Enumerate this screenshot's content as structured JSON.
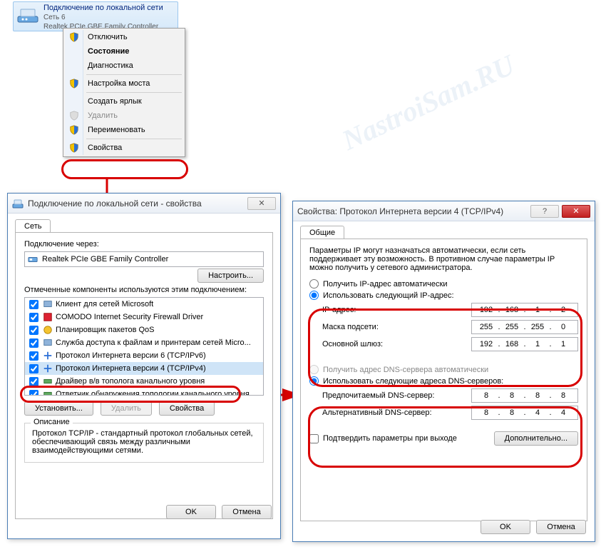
{
  "watermark": "NastroiSam.RU",
  "netcard": {
    "title": "Подключение по локальной сети",
    "sub1": "Сеть 6",
    "sub2": "Realtek PCIe GBE Family Controller"
  },
  "contextMenu": {
    "disable": "Отключить",
    "status": "Состояние",
    "diag": "Диагностика",
    "bridge": "Настройка моста",
    "shortcut": "Создать ярлык",
    "delete": "Удалить",
    "rename": "Переименовать",
    "properties": "Свойства"
  },
  "props": {
    "title": "Подключение по локальной сети - свойства",
    "tab_net": "Сеть",
    "conn_via": "Подключение через:",
    "adapter": "Realtek PCIe GBE Family Controller",
    "configure": "Настроить...",
    "comp_label": "Отмеченные компоненты используются этим подключением:",
    "components": [
      "Клиент для сетей Microsoft",
      "COMODO Internet Security Firewall Driver",
      "Планировщик пакетов QoS",
      "Служба доступа к файлам и принтерам сетей Micro...",
      "Протокол Интернета версии 6 (TCP/IPv6)",
      "Протокол Интернета версии 4 (TCP/IPv4)",
      "Драйвер в/в тополога канального уровня",
      "Ответчик обнаружения топологии канального уровня"
    ],
    "install": "Установить...",
    "remove": "Удалить",
    "properties": "Свойства",
    "desc_title": "Описание",
    "desc_text": "Протокол TCP/IP - стандартный протокол глобальных сетей, обеспечивающий связь между различными взаимодействующими сетями.",
    "ok": "OK",
    "cancel": "Отмена"
  },
  "ipv4": {
    "title": "Свойства: Протокол Интернета версии 4 (TCP/IPv4)",
    "tab_general": "Общие",
    "intro": "Параметры IP могут назначаться автоматически, если сеть поддерживает эту возможность. В противном случае параметры IP можно получить у сетевого администратора.",
    "ip_auto": "Получить IP-адрес автоматически",
    "ip_manual": "Использовать следующий IP-адрес:",
    "ip_label": "IP-адрес:",
    "mask_label": "Маска подсети:",
    "gw_label": "Основной шлюз:",
    "ip_value": [
      "192",
      "168",
      "1",
      "2"
    ],
    "mask_value": [
      "255",
      "255",
      "255",
      "0"
    ],
    "gw_value": [
      "192",
      "168",
      "1",
      "1"
    ],
    "dns_auto": "Получить адрес DNS-сервера автоматически",
    "dns_manual": "Использовать следующие адреса DNS-серверов:",
    "dns1_label": "Предпочитаемый DNS-сервер:",
    "dns2_label": "Альтернативный DNS-сервер:",
    "dns1_value": [
      "8",
      "8",
      "8",
      "8"
    ],
    "dns2_value": [
      "8",
      "8",
      "4",
      "4"
    ],
    "confirm_exit": "Подтвердить параметры при выходе",
    "advanced": "Дополнительно...",
    "ok": "OK",
    "cancel": "Отмена"
  }
}
